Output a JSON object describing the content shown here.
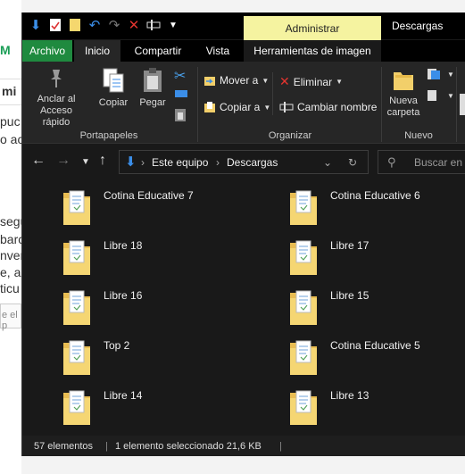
{
  "background_page": {
    "logo_fragment": "M",
    "search_fragment": "mi",
    "text_lines": [
      "puc",
      "o ac",
      "segu",
      "barc",
      "nver",
      "e, a",
      "ticu"
    ],
    "input_placeholder_fragment": "e el p"
  },
  "window": {
    "contextual_tab": "Administrar",
    "title": "Descargas",
    "tabs": [
      "Archivo",
      "Inicio",
      "Compartir",
      "Vista",
      "Herramientas de imagen"
    ],
    "active_tab": "Inicio"
  },
  "ribbon": {
    "portapapeles": {
      "label": "Portapapeles",
      "pin": "Anclar al\nAcceso rápido",
      "pin_line1": "Anclar al",
      "pin_line2": "Acceso rápido",
      "copy": "Copiar",
      "paste": "Pegar"
    },
    "organizar": {
      "label": "Organizar",
      "move": "Mover a",
      "copy_to": "Copiar a",
      "delete": "Eliminar",
      "rename": "Cambiar nombre"
    },
    "nuevo": {
      "label": "Nuevo",
      "new_folder_line1": "Nueva",
      "new_folder_line2": "carpeta"
    }
  },
  "address": {
    "crumbs": [
      "Este equipo",
      "Descargas"
    ],
    "search_placeholder": "Buscar en D"
  },
  "items": [
    {
      "name": "Cotina Educative 7"
    },
    {
      "name": "Cotina Educative 6"
    },
    {
      "name": "Libre 18"
    },
    {
      "name": "Libre 17"
    },
    {
      "name": "Libre 16"
    },
    {
      "name": "Libre 15"
    },
    {
      "name": "Top 2"
    },
    {
      "name": "Cotina Educative 5"
    },
    {
      "name": "Libre 14"
    },
    {
      "name": "Libre 13"
    }
  ],
  "status": {
    "count": "57 elementos",
    "selection": "1 elemento seleccionado  21,6 KB"
  },
  "colors": {
    "archivo_tab": "#1f8a3f",
    "contextual_tab": "#f5f3a0",
    "window_bg": "#191919",
    "folder": "#f2cf6a"
  }
}
